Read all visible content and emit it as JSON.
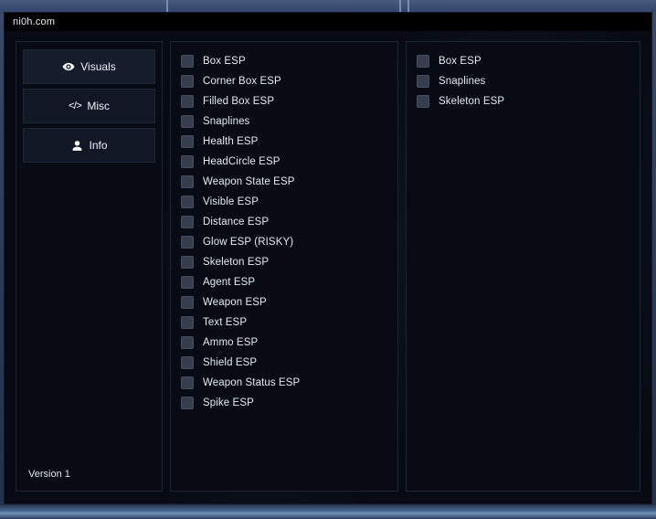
{
  "window": {
    "title": "ni0h.com"
  },
  "sidebar": {
    "items": [
      {
        "label": "Visuals",
        "icon": "eye-icon",
        "active": true
      },
      {
        "label": "Misc",
        "icon": "code-icon",
        "active": false
      },
      {
        "label": "Info",
        "icon": "person-icon",
        "active": false
      }
    ],
    "version_label": "Version 1"
  },
  "panels": {
    "main": {
      "options": [
        {
          "label": "Box ESP",
          "checked": false
        },
        {
          "label": "Corner Box ESP",
          "checked": false
        },
        {
          "label": "Filled Box ESP",
          "checked": false
        },
        {
          "label": "Snaplines",
          "checked": false
        },
        {
          "label": "Health ESP",
          "checked": false
        },
        {
          "label": "HeadCircle ESP",
          "checked": false
        },
        {
          "label": "Weapon State ESP",
          "checked": false
        },
        {
          "label": "Visible ESP",
          "checked": false
        },
        {
          "label": "Distance ESP",
          "checked": false
        },
        {
          "label": "Glow ESP (RISKY)",
          "checked": false
        },
        {
          "label": "Skeleton ESP",
          "checked": false
        },
        {
          "label": "Agent ESP",
          "checked": false
        },
        {
          "label": "Weapon ESP",
          "checked": false
        },
        {
          "label": "Text ESP",
          "checked": false
        },
        {
          "label": "Ammo ESP",
          "checked": false
        },
        {
          "label": "Shield ESP",
          "checked": false
        },
        {
          "label": "Weapon Status ESP",
          "checked": false
        },
        {
          "label": "Spike ESP",
          "checked": false
        }
      ]
    },
    "side": {
      "options": [
        {
          "label": "Box ESP",
          "checked": false
        },
        {
          "label": "Snaplines",
          "checked": false
        },
        {
          "label": "Skeleton ESP",
          "checked": false
        }
      ]
    }
  },
  "colors": {
    "window_background": "#070a12",
    "panel_background": "#080b13",
    "panel_border": "#1b2536",
    "titlebar_background": "#000000",
    "text": "#e4e9f2",
    "checkbox": "#363d4d",
    "desktop_top": "#4a5b7d"
  }
}
